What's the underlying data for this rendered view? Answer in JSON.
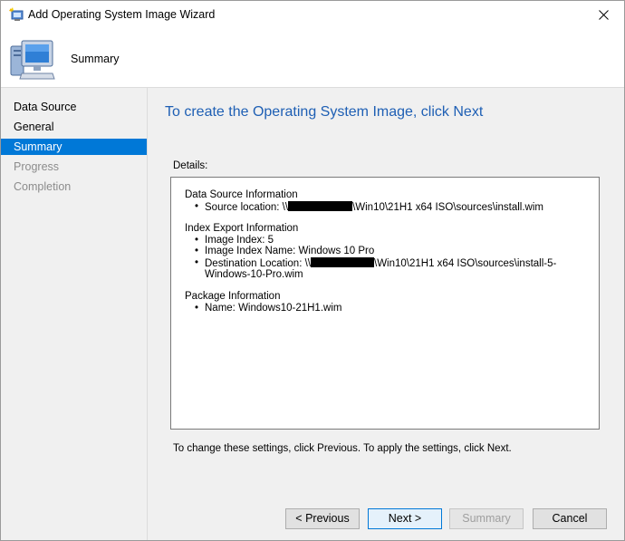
{
  "window": {
    "title": "Add Operating System Image Wizard",
    "close_icon": "close-icon"
  },
  "header": {
    "title": "Summary",
    "icon": "computer-icon"
  },
  "nav": {
    "items": [
      {
        "label": "Data Source",
        "state": "done"
      },
      {
        "label": "General",
        "state": "done"
      },
      {
        "label": "Summary",
        "state": "active"
      },
      {
        "label": "Progress",
        "state": "disabled"
      },
      {
        "label": "Completion",
        "state": "disabled"
      }
    ]
  },
  "main": {
    "heading": "To create the Operating System Image, click Next",
    "details_label": "Details:",
    "details": {
      "data_source": {
        "title": "Data Source Information",
        "source_prefix": "Source location: \\\\",
        "source_suffix": "\\Win10\\21H1 x64 ISO\\sources\\install.wim"
      },
      "index_export": {
        "title": "Index Export Information",
        "image_index": "Image Index: 5",
        "image_index_name": "Image Index Name: Windows 10 Pro",
        "dest_prefix": "Destination Location: \\\\",
        "dest_suffix": "\\Win10\\21H1 x64 ISO\\sources\\install-5-",
        "dest_line2": "Windows-10-Pro.wim"
      },
      "package": {
        "title": "Package Information",
        "name": "Name: Windows10-21H1.wim"
      }
    },
    "footnote": "To change these settings, click Previous. To apply the settings, click Next."
  },
  "buttons": {
    "previous": "< Previous",
    "next": "Next >",
    "summary": "Summary",
    "cancel": "Cancel"
  },
  "colors": {
    "accent": "#0078d7",
    "heading": "#1e5fb4",
    "panel": "#f0f0f0"
  }
}
